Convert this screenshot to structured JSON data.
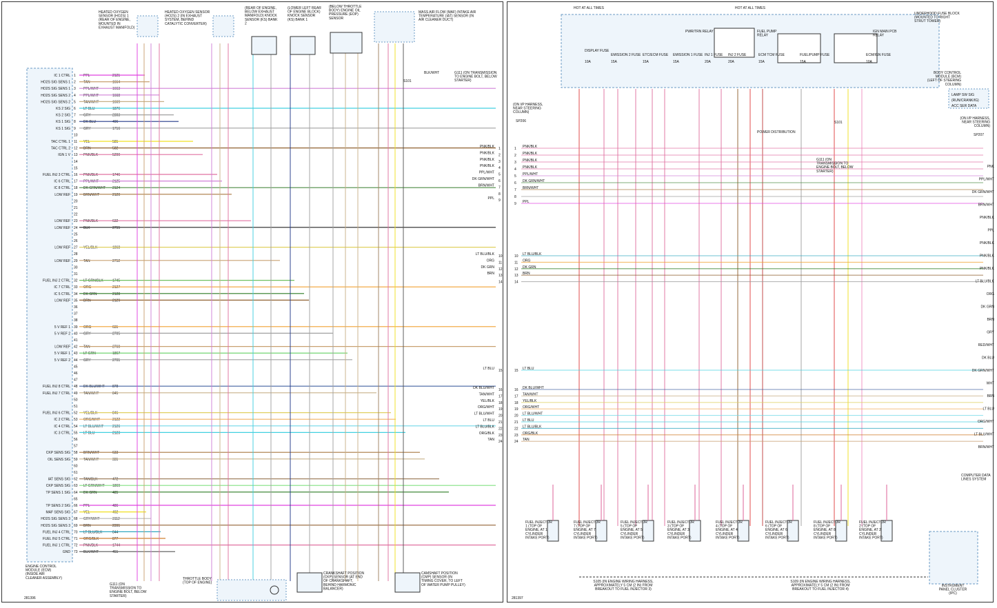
{
  "left_sheet": {
    "ecm_pins": [
      {
        "label": "IC 1 CTRL",
        "pin": "1",
        "wire": "PPL",
        "circ": "2121"
      },
      {
        "label": "HO2S SIG SENS 1",
        "pin": "2",
        "wire": "TAN",
        "circ": "1664"
      },
      {
        "label": "HO2S SIG SENS 1",
        "pin": "3",
        "wire": "PPL/WHT",
        "circ": "1663"
      },
      {
        "label": "HO2S SIG SENS 2",
        "pin": "4",
        "wire": "PPL/WHT",
        "circ": "1668"
      },
      {
        "label": "HO2S SIG SENS 2",
        "pin": "5",
        "wire": "TAN/WHT",
        "circ": "1669"
      },
      {
        "label": "KS 2 SIG",
        "pin": "6",
        "wire": "LT BLU",
        "circ": "1876"
      },
      {
        "label": "KS 2 SIG",
        "pin": "7",
        "wire": "GRY",
        "circ": "2303"
      },
      {
        "label": "KS 1 SIG",
        "pin": "8",
        "wire": "DK BLU",
        "circ": "496"
      },
      {
        "label": "KS 1 SIG",
        "pin": "9",
        "wire": "GRY",
        "circ": "1716"
      },
      {
        "label": "TAC CTRL 1",
        "pin": "11",
        "wire": "YEL",
        "circ": "581"
      },
      {
        "label": "TAC CTRL 2",
        "pin": "12",
        "wire": "BRN",
        "circ": "582"
      },
      {
        "label": "IGN 1 V",
        "pin": "13",
        "wire": "PNK/BLK",
        "circ": "5290"
      },
      {
        "label": "FUEL INJ 3 CTRL",
        "pin": "16",
        "wire": "PNK/BLK",
        "circ": "1746"
      },
      {
        "label": "IC 6 CTRL",
        "pin": "17",
        "wire": "PPL/WHT",
        "circ": "2125"
      },
      {
        "label": "IC 8 CTRL",
        "pin": "18",
        "wire": "DK GRN/WHT",
        "circ": "2124"
      },
      {
        "label": "LOW REF",
        "pin": "19",
        "wire": "BRN/WHT",
        "circ": "2120"
      },
      {
        "label": "LOW REF",
        "pin": "23",
        "wire": "PNK/BLK",
        "circ": "632"
      },
      {
        "label": "LOW REF",
        "pin": "24",
        "wire": "BLK",
        "circ": "2755"
      },
      {
        "label": "LOW REF",
        "pin": "27",
        "wire": "YEL/BLK",
        "circ": "1868"
      },
      {
        "label": "LOW REF",
        "pin": "29",
        "wire": "TAN",
        "circ": "2752"
      },
      {
        "label": "FUEL INJ 2 CTRL",
        "pin": "32",
        "wire": "LT GRN/BLK",
        "circ": "1745"
      },
      {
        "label": "IC 7 CTRL",
        "pin": "33",
        "wire": "ORG",
        "circ": "2127"
      },
      {
        "label": "IC 5 CTRL",
        "pin": "34",
        "wire": "DK GRN",
        "circ": "2128"
      },
      {
        "label": "LOW REF",
        "pin": "35",
        "wire": "BRN",
        "circ": "2129"
      },
      {
        "label": "5 V REF 1",
        "pin": "39",
        "wire": "ORG",
        "circ": "631"
      },
      {
        "label": "5 V REF 2",
        "pin": "40",
        "wire": "GRY",
        "circ": "2705"
      },
      {
        "label": "LOW REF",
        "pin": "42",
        "wire": "TAN",
        "circ": "2760"
      },
      {
        "label": "5 V REF 1",
        "pin": "43",
        "wire": "LT GRN",
        "circ": "1867"
      },
      {
        "label": "5 V REF 2",
        "pin": "44",
        "wire": "GRY",
        "circ": "2701"
      },
      {
        "label": "FUEL INJ 8 CTRL",
        "pin": "48",
        "wire": "DK BLU/WHT",
        "circ": "878"
      },
      {
        "label": "FUEL INJ 7 CTRL",
        "pin": "49",
        "wire": "TAN/WHT",
        "circ": "845"
      },
      {
        "label": "FUEL INJ 6 CTRL",
        "pin": "52",
        "wire": "YEL/BLK",
        "circ": "846"
      },
      {
        "label": "IC 2 CTRL",
        "pin": "53",
        "wire": "ORG/WHT",
        "circ": "2122"
      },
      {
        "label": "IC 4 CTRL",
        "pin": "54",
        "wire": "LT BLU/WHT",
        "circ": "2126"
      },
      {
        "label": "IC 3 CTRL",
        "pin": "55",
        "wire": "LT BLU",
        "circ": "2123"
      },
      {
        "label": "CKP SENS SIG",
        "pin": "58",
        "wire": "BRN/WHT",
        "circ": "633"
      },
      {
        "label": "OIL SENS SIG",
        "pin": "59",
        "wire": "TAN/WHT",
        "circ": "331"
      },
      {
        "label": "IAT SENS SIG",
        "pin": "62",
        "wire": "TAN/BLK",
        "circ": "472"
      },
      {
        "label": "CKP SENS SIG",
        "pin": "63",
        "wire": "LT GRN/WHT",
        "circ": "1869"
      },
      {
        "label": "TP SENS 1 SIG",
        "pin": "64",
        "wire": "DK GRN",
        "circ": "485"
      },
      {
        "label": "TP SENS 2 SIG",
        "pin": "66",
        "wire": "PPL",
        "circ": "486"
      },
      {
        "label": "MAF SENS SIG",
        "pin": "67",
        "wire": "YEL",
        "circ": "492"
      },
      {
        "label": "HO2S SIG SENS 3",
        "pin": "68",
        "wire": "GRY/WHT",
        "circ": "3112"
      },
      {
        "label": "HO2S SIG SENS 3",
        "pin": "69",
        "wire": "BRN",
        "circ": "2391"
      },
      {
        "label": "FUEL INJ 4 CTRL",
        "pin": "70",
        "wire": "LT BLU/BLK",
        "circ": "844"
      },
      {
        "label": "FUEL INJ 5 CTRL",
        "pin": "71",
        "wire": "ORG/BLK",
        "circ": "877"
      },
      {
        "label": "FUEL INJ 1 CTRL",
        "pin": "72",
        "wire": "PNK/BLK",
        "circ": "1744"
      },
      {
        "label": "GND",
        "pin": "73",
        "wire": "BLK/WHT",
        "circ": "451"
      }
    ],
    "ecm_caption": "ENGINE CONTROL MODULE (ECM) (INSIDE AIR CLEANER ASSEMBLY)",
    "ground_left": "G111 (ON TRANSMISSION TO ENGINE BOLT, BELOW STARTER)",
    "components": [
      {
        "label": "HEATED OXYGEN SENSOR (HO2S) 1 (REAR OF ENGINE, MOUNTED IN EXHAUST MANIFOLD)"
      },
      {
        "label": "HEATED OXYGEN SENSOR (HO2S) 2 (IN EXHAUST SYSTEM, BEHIND CATALYTIC CONVERTER)"
      },
      {
        "label": "(REAR OF ENGINE, BELOW EXHAUST MANIFOLD) KNOCK SENSOR (KS) BANK 2"
      },
      {
        "label": "(LOWER LEFT REAR OF ENGINE BLOCK) KNOCK SENSOR (KS) BANK 1"
      },
      {
        "label": "(BELOW THROTTLE BODY) ENGINE OIL PRESSURE (EOP) SENSOR"
      },
      {
        "label": "MASS AIR FLOW (MAF) INTAKE AIR TEMPERATURE (IAT) SENSOR (IN AIR CLEANER DUCT)"
      },
      {
        "label": "THROTTLE BODY (TOP OF ENGINE)"
      },
      {
        "label": "CRANKSHAFT POSITION (CKP) SENSOR (AT END OF CRANKSHAFT, BEHIND HARMONIC BALANCER)"
      },
      {
        "label": "CAMSHAFT POSITION (CMP) SENSOR (IN TIMING COVER, TO LEFT OF WATER PUMP PULLEY)"
      }
    ],
    "ground_maf": "G111 (ON TRANSMISSION TO ENGINE BOLT, BELOW STARTER)",
    "splice_maf": "S101",
    "maf_wire": "BLK/WHT",
    "exit_numbers": [
      "1",
      "2",
      "3",
      "4",
      "5",
      "6",
      "7",
      "8",
      "9",
      "10",
      "11",
      "12",
      "13",
      "14",
      "15",
      "16",
      "17",
      "18",
      "19",
      "20",
      "21",
      "22",
      "23",
      "24"
    ],
    "exit_wires": [
      "PNK/BLK",
      "PNK/BLK",
      "PNK/BLK",
      "PNK/BLK",
      "PPL/WHT",
      "DK GRN/WHT",
      "BRN/WHT",
      "",
      "PPL",
      "LT BLU/BLK",
      "ORG",
      "DK GRN",
      "BRN",
      "",
      "LT BLU",
      "DK BLU/WHT",
      "TAN/WHT",
      "YEL/BLK",
      "ORG/WHT",
      "LT BLU/WHT",
      "LT BLU",
      "LT BLU/BLK",
      "ORG/BLK",
      "TAN"
    ],
    "footer_id": "281396"
  },
  "right_sheet": {
    "hot1": "HOT AT ALL TIMES",
    "hot2": "HOT AT ALL TIMES",
    "fuse_block_label": "UNDERHOOD FUSE BLOCK (MOUNTED TO RIGHT STRUT TOWER)",
    "fuses": [
      {
        "name": "DISPLAY FUSE",
        "amps": "10A"
      },
      {
        "name": "EMISSION 2 FUSE",
        "amps": "15A"
      },
      {
        "name": "ETC/ECM FUSE",
        "amps": "15A"
      },
      {
        "name": "EMISSION 1 FUSE",
        "amps": "15A"
      },
      {
        "name": "INJ 1 FUSE",
        "amps": "20A"
      },
      {
        "name": "INJ 2 FUSE",
        "amps": "20A"
      },
      {
        "name": "ECM TCM FUSE",
        "amps": "15A"
      },
      {
        "name": "FUEL/PUMP FUSE",
        "amps": "15A"
      },
      {
        "name": "ECM/IGN FUSE",
        "amps": "10A"
      }
    ],
    "relays": [
      "PWR/TRN RELAY",
      "FUEL PUMP RELAY",
      "IGN MAIN PCB RELAY"
    ],
    "bcm_label": "BODY CONTROL MODULE (BCM) (LEFT OF STEERING COLUMN)",
    "bcm_pins": [
      "LAMP SW SIG",
      "(RUN/CRANK/IG)",
      "ACC SER DATA"
    ],
    "ip_harness_left": "(ON I/P HARNESS, NEAR STEERING COLUMN)",
    "ip_harness_right": "(ON I/P HARNESS, NEAR STEERING COLUMN)",
    "sp206": "SP206",
    "sp207": "SP207",
    "s101": "S101",
    "g111": "G111 (ON TRANSMISSION TO ENGINE BOLT, BELOW STARTER)",
    "power_dist": "POWER DISTRIBUTION",
    "computer_data": "COMPUTER DATA LINES SYSTEM",
    "ipc_label": "INSTRUMENT PANEL CLUSTER (IPC)",
    "injectors": [
      {
        "label": "FUEL INJECTOR 1 (TOP OF ENGINE, AT 1 CYLINDER INTAKE PORT)"
      },
      {
        "label": "FUEL INJECTOR 7 (TOP OF ENGINE, AT 7 CYLINDER INTAKE PORT)"
      },
      {
        "label": "FUEL INJECTOR 5 (TOP OF ENGINE, AT 5 CYLINDER INTAKE PORT)"
      },
      {
        "label": "FUEL INJECTOR 3 (TOP OF ENGINE, AT 3 CYLINDER INTAKE PORT)"
      },
      {
        "label": "FUEL INJECTOR 4 (TOP OF ENGINE, AT 4 CYLINDER INTAKE PORT)"
      },
      {
        "label": "FUEL INJECTOR 6 (TOP OF ENGINE, AT 6 CYLINDER INTAKE PORT)"
      },
      {
        "label": "FUEL INJECTOR 8 (TOP OF ENGINE, AT 8 CYLINDER INTAKE PORT)"
      },
      {
        "label": "FUEL INJECTOR 2 (TOP OF ENGINE, AT 2 CYLINDER INTAKE PORT)"
      }
    ],
    "splice_s105": "S105 (IN ENGINE WIRING HARNESS, APPROXIMATELY 5 CM (2 IN) FROM BREAKOUT TO FUEL INJECTOR 3)",
    "splice_s109": "S109 (IN ENGINE WIRING HARNESS, APPROXIMATELY 5 CM (2 IN) FROM BREAKOUT TO FUEL INJECTOR 4)",
    "left_wires": [
      "PNK/BLK",
      "PNK/BLK",
      "PNK/BLK",
      "PNK/BLK",
      "PPL/WHT",
      "DK GRN/WHT",
      "BRN/WHT",
      "",
      "PPL",
      "LT BLU/BLK",
      "ORG",
      "DK GRN",
      "BRN",
      "",
      "LT BLU",
      "DK BLU/WHT",
      "TAN/WHT",
      "YEL/BLK",
      "ORG/WHT",
      "LT BLU/WHT",
      "LT BLU",
      "LT BLU/BLK",
      "ORG/BLK",
      "TAN"
    ],
    "right_wires": [
      "PNK",
      "PPL/WHT",
      "DK GRN/WHT",
      "BRN/WHT",
      "PNK/BLK",
      "PPL",
      "PNK/BLK",
      "PNK/BLK",
      "PNK/BLK",
      "LT BLU/BLK",
      "ORG",
      "DK GRN",
      "BRN",
      "GRY",
      "RED/WHT",
      "DK BLU",
      "DK GRN/WHT",
      "WHT",
      "BRN",
      "LT BLU",
      "ORG/WHT",
      "LT BLU/WHT",
      "BRN/WHT"
    ],
    "footer_id": "281397"
  }
}
